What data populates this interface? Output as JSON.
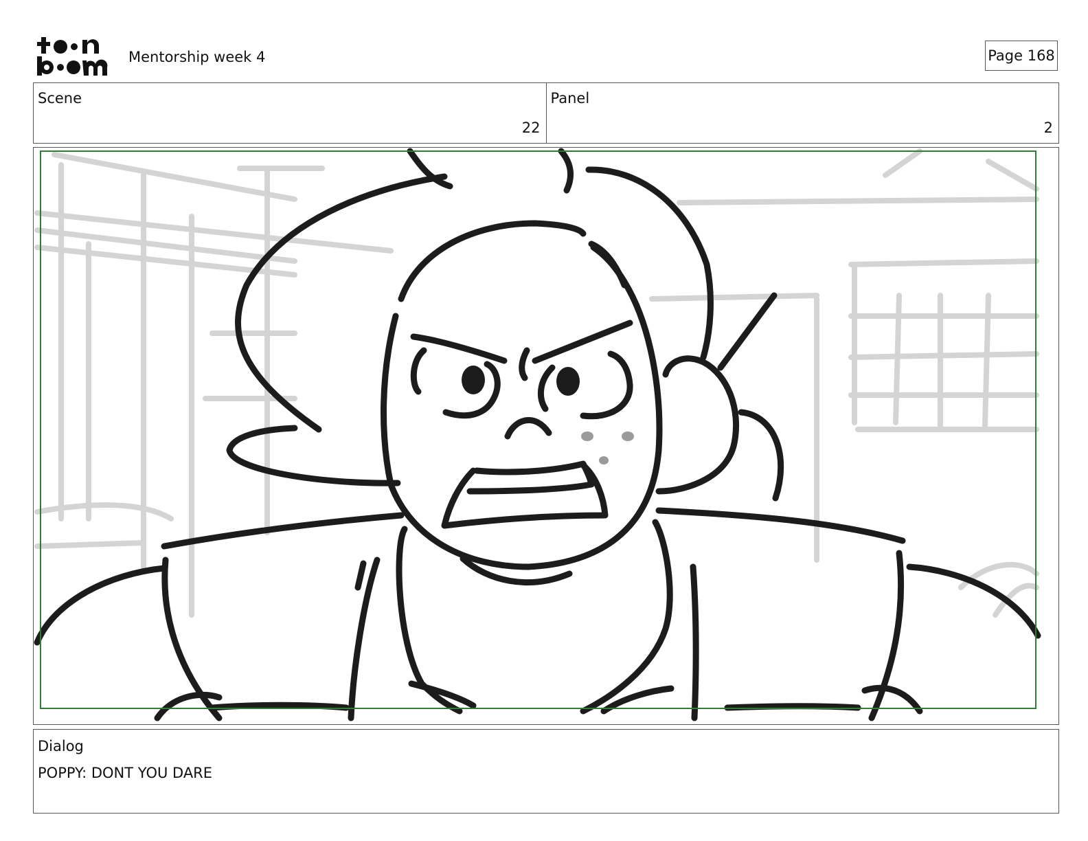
{
  "header": {
    "logo_text": "toon boom",
    "title": "Mentorship week 4",
    "page_label": "Page 168"
  },
  "scene": {
    "label": "Scene",
    "value": "22"
  },
  "panel": {
    "label": "Panel",
    "value": "2"
  },
  "dialog": {
    "label": "Dialog",
    "text": "POPPY: DONT YOU DARE"
  },
  "colors": {
    "safe_frame": "#2e7d32",
    "ink": "#1c1c1c",
    "background_sketch": "#d4d4d4",
    "freckles": "#9a9a9a"
  }
}
